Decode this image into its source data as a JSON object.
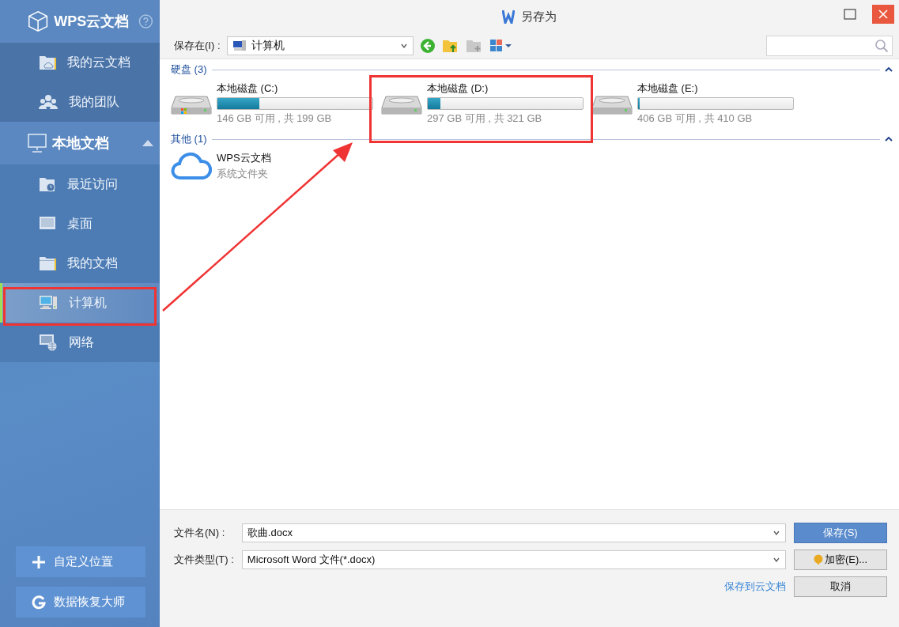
{
  "dialog": {
    "title": "另存为"
  },
  "cloud_section": {
    "title": "WPS云文档",
    "items": [
      {
        "label": "我的云文档",
        "kind": "cloudfolder",
        "selected": false
      },
      {
        "label": "我的团队",
        "kind": "team",
        "selected": false
      }
    ]
  },
  "local_section": {
    "title": "本地文档",
    "expanded": true,
    "items": [
      {
        "label": "最近访问",
        "kind": "recent",
        "selected": false
      },
      {
        "label": "桌面",
        "kind": "desktop",
        "selected": false
      },
      {
        "label": "我的文档",
        "kind": "folder",
        "selected": false
      },
      {
        "label": "计算机",
        "kind": "computer",
        "selected": true
      },
      {
        "label": "网络",
        "kind": "network",
        "selected": false
      }
    ]
  },
  "sidebar_buttons": [
    {
      "label": "自定义位置",
      "kind": "add"
    },
    {
      "label": "数据恢复大师",
      "kind": "recover"
    }
  ],
  "toolbar": {
    "location_label": "保存在(I) :",
    "location_value": "计算机"
  },
  "groups": [
    {
      "title": "硬盘 (3)",
      "expanded": true,
      "items": [
        {
          "kind": "drive",
          "name": "本地磁盘 (C:)",
          "level": 0.27,
          "detail": "146 GB 可用 , 共 199 GB",
          "windows": true
        },
        {
          "kind": "drive",
          "name": "本地磁盘 (D:)",
          "level": 0.08,
          "detail": "297 GB 可用 , 共 321 GB",
          "windows": false
        },
        {
          "kind": "drive",
          "name": "本地磁盘 (E:)",
          "level": 0.01,
          "detail": "406 GB 可用 , 共 410 GB",
          "windows": false
        }
      ]
    },
    {
      "title": "其他 (1)",
      "expanded": true,
      "items": [
        {
          "kind": "cloud",
          "name": "WPS云文档",
          "detail": "系统文件夹"
        }
      ]
    }
  ],
  "footer": {
    "filename_label": "文件名(N) :",
    "filename_value": "歌曲.docx",
    "filetype_label": "文件类型(T) :",
    "filetype_value": "Microsoft Word 文件(*.docx)",
    "cloud_link": "保存到云文档",
    "save_button": "保存(S)",
    "encrypt_button": "加密(E)...",
    "cancel_button": "取消"
  }
}
